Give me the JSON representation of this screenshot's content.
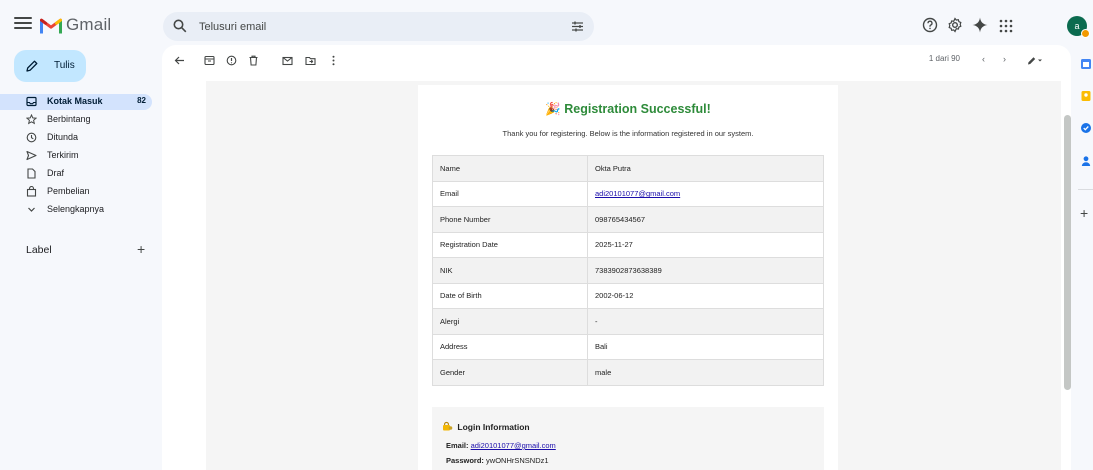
{
  "app": {
    "name": "Gmail"
  },
  "search": {
    "placeholder": "Telusuri email"
  },
  "compose": {
    "label": "Tulis"
  },
  "sidebar": {
    "items": [
      {
        "label": "Kotak Masuk",
        "count": "82"
      },
      {
        "label": "Berbintang"
      },
      {
        "label": "Ditunda"
      },
      {
        "label": "Terkirim"
      },
      {
        "label": "Draf"
      },
      {
        "label": "Pembelian"
      },
      {
        "label": "Selengkapnya"
      }
    ],
    "labels_heading": "Label"
  },
  "toolbar": {
    "pager": "1 dari 90"
  },
  "email": {
    "title_emoji": "🎉",
    "title": "Registration Successful!",
    "intro": "Thank you for registering. Below is the information registered in our system.",
    "rows": [
      {
        "key": "Name",
        "value": "Okta Putra"
      },
      {
        "key": "Email",
        "value": "adi20101077@gmail.com",
        "link": true
      },
      {
        "key": "Phone Number",
        "value": "098765434567"
      },
      {
        "key": "Registration Date",
        "value": "2025-11-27"
      },
      {
        "key": "NIK",
        "value": "7383902873638389"
      },
      {
        "key": "Date of Birth",
        "value": "2002-06-12"
      },
      {
        "key": "Alergi",
        "value": "-"
      },
      {
        "key": "Address",
        "value": "Bali"
      },
      {
        "key": "Gender",
        "value": "male"
      }
    ],
    "login": {
      "title": "Login Information",
      "email_label": "Email:",
      "email_value": "adi20101077@gmail.com",
      "password_label": "Password:",
      "password_value": "ywONHrSNSNDz1"
    }
  },
  "avatar": {
    "initial": "a"
  },
  "colors": {
    "accent": "#c2e7ff",
    "active_nav": "#d3e3fd",
    "title_green": "#2e8b3a",
    "link": "#1a0dab"
  }
}
